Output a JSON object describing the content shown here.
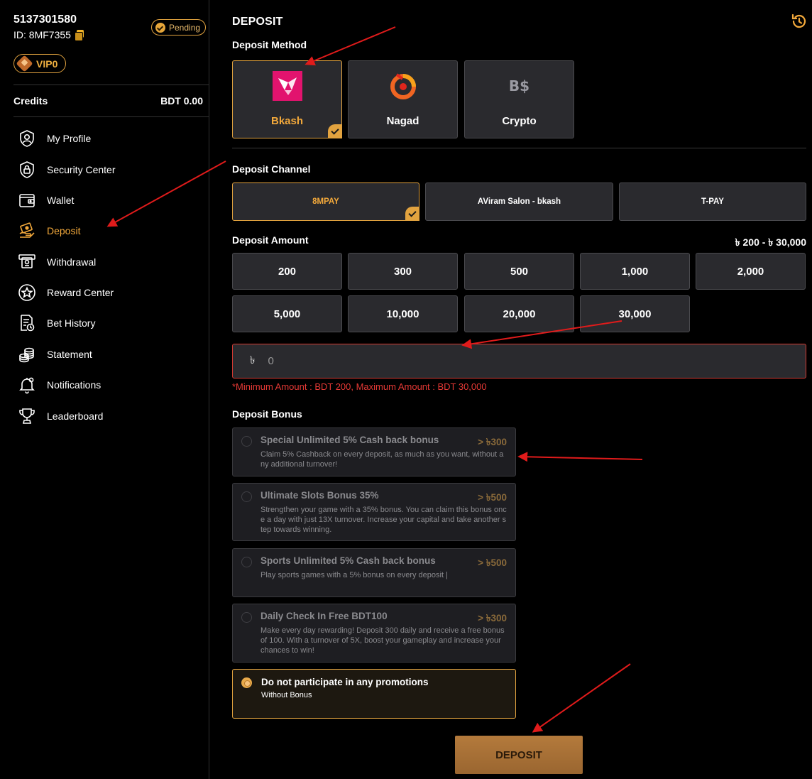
{
  "user": {
    "number": "5137301580",
    "id_text": "ID: 8MF7355",
    "status": "Pending",
    "vip": "VIP0"
  },
  "credits": {
    "label": "Credits",
    "value": "BDT  0.00"
  },
  "nav": [
    {
      "label": "My Profile",
      "icon": "profile-icon"
    },
    {
      "label": "Security Center",
      "icon": "shield-lock-icon"
    },
    {
      "label": "Wallet",
      "icon": "wallet-icon"
    },
    {
      "label": "Deposit",
      "icon": "deposit-icon",
      "active": true
    },
    {
      "label": "Withdrawal",
      "icon": "withdrawal-icon"
    },
    {
      "label": "Reward Center",
      "icon": "star-icon"
    },
    {
      "label": "Bet History",
      "icon": "bet-history-icon"
    },
    {
      "label": "Statement",
      "icon": "coins-icon"
    },
    {
      "label": "Notifications",
      "icon": "bell-icon"
    },
    {
      "label": "Leaderboard",
      "icon": "trophy-icon"
    }
  ],
  "main": {
    "title": "DEPOSIT",
    "method_label": "Deposit Method",
    "methods": [
      {
        "label": "Bkash",
        "icon": "bkash-logo-icon",
        "selected": true
      },
      {
        "label": "Nagad",
        "icon": "nagad-logo-icon"
      },
      {
        "label": "Crypto",
        "icon": "crypto-logo-icon"
      }
    ],
    "crypto_logo_text": "B$",
    "channel_label": "Deposit Channel",
    "channels": [
      {
        "label": "8MPAY",
        "selected": true
      },
      {
        "label": "AViram Salon - bkash"
      },
      {
        "label": "T-PAY"
      }
    ],
    "amount_label": "Deposit Amount",
    "amount_range": "৳ 200 - ৳ 30,000",
    "amounts": [
      "200",
      "300",
      "500",
      "1,000",
      "2,000",
      "5,000",
      "10,000",
      "20,000",
      "30,000"
    ],
    "amount_input": {
      "currency": "৳",
      "placeholder": "0"
    },
    "amount_error": "*Minimum Amount : BDT 200, Maximum Amount : BDT 30,000",
    "bonus_label": "Deposit Bonus",
    "bonuses": [
      {
        "title": "Special Unlimited 5% Cash back bonus",
        "amount": "> ৳300",
        "desc": "Claim 5% Cashback on every deposit, as much as you want, without any additional turnover!"
      },
      {
        "title": "Ultimate Slots Bonus 35%",
        "amount": "> ৳500",
        "desc": "Strengthen your game with a 35% bonus. You can claim this bonus once a day with just 13X turnover. Increase your capital and take another step towards winning."
      },
      {
        "title": "Sports Unlimited 5% Cash back bonus",
        "amount": "> ৳500",
        "desc": "Play sports games with a 5% bonus on every deposit |"
      },
      {
        "title": "Daily Check In Free BDT100",
        "amount": "> ৳300",
        "desc": "Make every day rewarding! Deposit 300 daily and receive a free bonus of 100. With a turnover of 5X, boost your gameplay and increase your chances to win!"
      },
      {
        "title": "Do not participate in any promotions",
        "amount": "",
        "desc": "Without Bonus",
        "selected": true
      }
    ],
    "deposit_button": "DEPOSIT"
  },
  "colors": {
    "accent": "#f3a93b",
    "background": "#000000",
    "card": "#2a2a2e",
    "error": "#e53935",
    "annotation_arrow": "#e01b1b"
  }
}
